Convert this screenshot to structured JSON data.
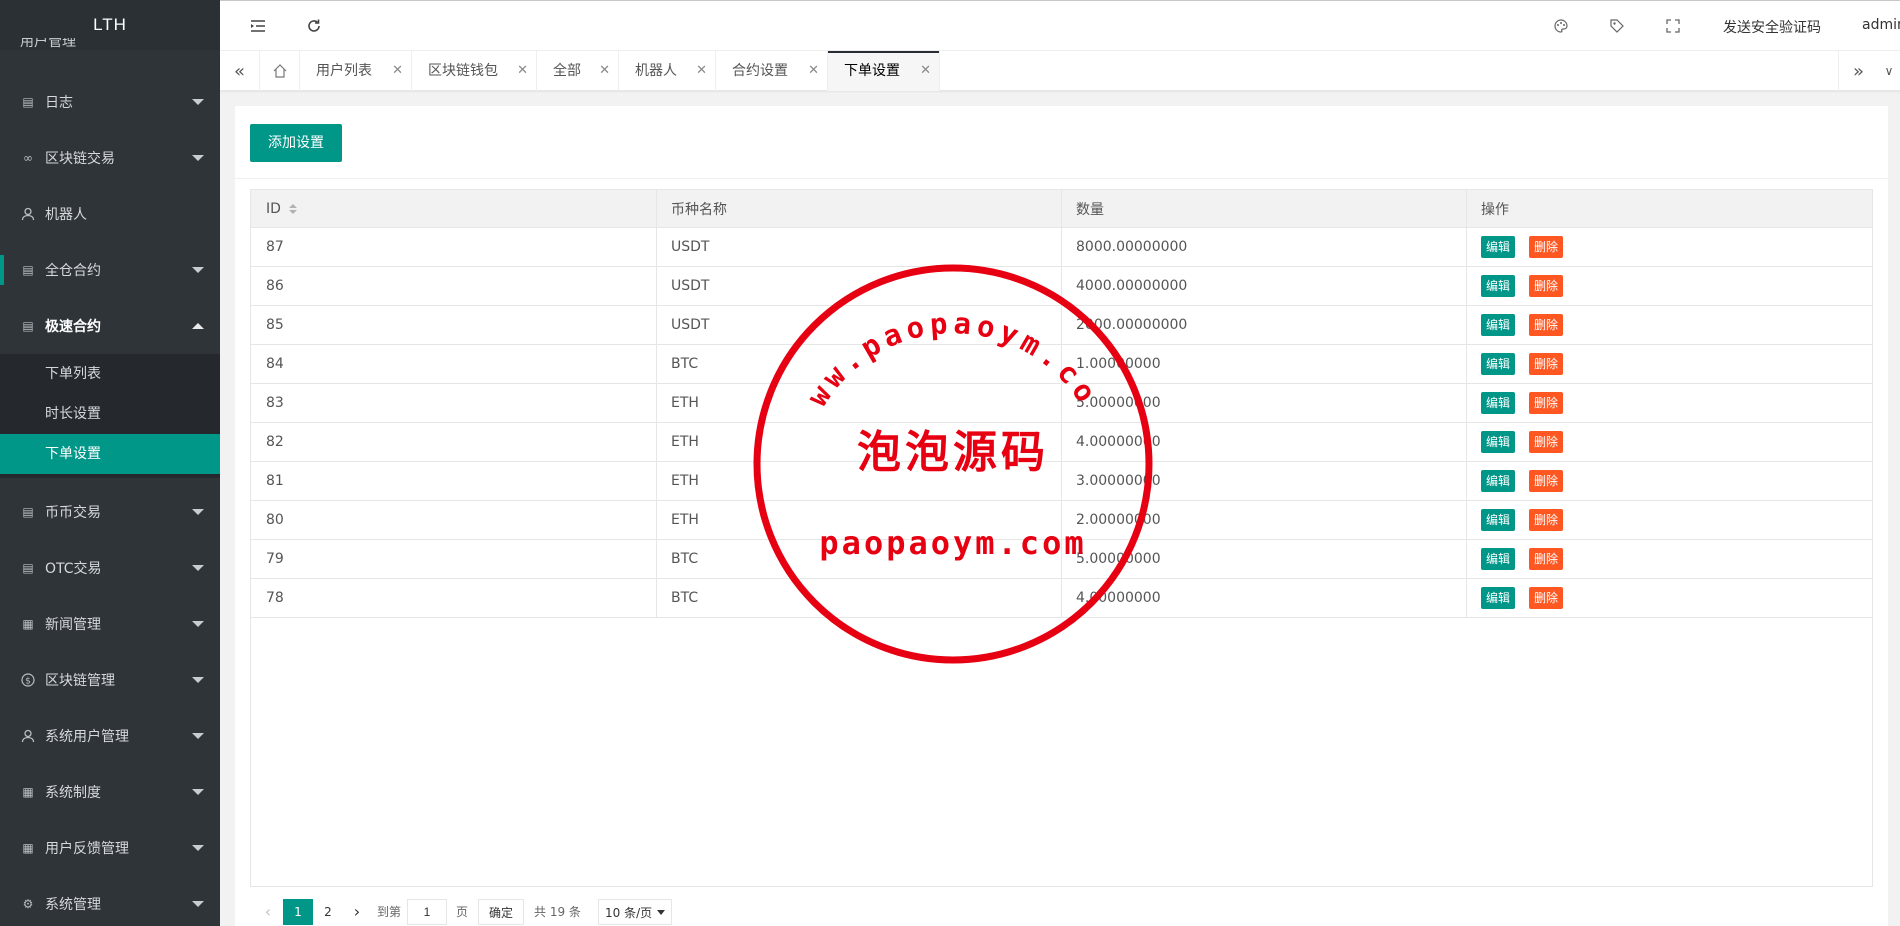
{
  "sidebar": {
    "logo": "LTH",
    "partial_item": "用户管理",
    "items": [
      {
        "label": "日志",
        "icon": "doc-icon",
        "arrow": "down"
      },
      {
        "label": "区块链交易",
        "icon": "link-icon",
        "arrow": "down"
      },
      {
        "label": "机器人",
        "icon": "user-icon",
        "arrow": ""
      },
      {
        "label": "全仓合约",
        "icon": "doc-icon",
        "arrow": "down"
      },
      {
        "label": "极速合约",
        "icon": "doc-icon",
        "arrow": "up"
      },
      {
        "label": "币币交易",
        "icon": "doc-icon",
        "arrow": "down"
      },
      {
        "label": "OTC交易",
        "icon": "doc-icon",
        "arrow": "down"
      },
      {
        "label": "新闻管理",
        "icon": "news-icon",
        "arrow": "down"
      },
      {
        "label": "区块链管理",
        "icon": "dollar-icon",
        "arrow": "down"
      },
      {
        "label": "系统用户管理",
        "icon": "user-icon",
        "arrow": "down"
      },
      {
        "label": "系统制度",
        "icon": "news-icon",
        "arrow": "down"
      },
      {
        "label": "用户反馈管理",
        "icon": "news-icon",
        "arrow": "down"
      },
      {
        "label": "系统管理",
        "icon": "gear-icon",
        "arrow": "down"
      }
    ],
    "submenu": [
      "下单列表",
      "时长设置",
      "下单设置"
    ]
  },
  "header": {
    "send_code": "发送安全验证码",
    "user": "admin"
  },
  "tabs": [
    "用户列表",
    "区块链钱包",
    "全部",
    "机器人",
    "合约设置",
    "下单设置"
  ],
  "toolbar": {
    "add_label": "添加设置"
  },
  "table": {
    "headers": [
      "ID",
      "币种名称",
      "数量",
      "操作"
    ],
    "edit_label": "编辑",
    "delete_label": "删除",
    "rows": [
      {
        "id": "87",
        "coin": "USDT",
        "amount": "8000.00000000"
      },
      {
        "id": "86",
        "coin": "USDT",
        "amount": "4000.00000000"
      },
      {
        "id": "85",
        "coin": "USDT",
        "amount": "2000.00000000"
      },
      {
        "id": "84",
        "coin": "BTC",
        "amount": "1.00000000"
      },
      {
        "id": "83",
        "coin": "ETH",
        "amount": "5.00000000"
      },
      {
        "id": "82",
        "coin": "ETH",
        "amount": "4.00000000"
      },
      {
        "id": "81",
        "coin": "ETH",
        "amount": "3.00000000"
      },
      {
        "id": "80",
        "coin": "ETH",
        "amount": "2.00000000"
      },
      {
        "id": "79",
        "coin": "BTC",
        "amount": "5.00000000"
      },
      {
        "id": "78",
        "coin": "BTC",
        "amount": "4.00000000"
      }
    ]
  },
  "pager": {
    "pages": [
      "1",
      "2"
    ],
    "goto_label": "到第",
    "goto_value": "1",
    "page_unit": "页",
    "confirm": "确定",
    "total": "共 19 条",
    "per_page": "10 条/页"
  },
  "watermark": {
    "arc_text": "www.paopaoym.com",
    "center_text": "泡泡源码",
    "bottom_text": "paopaoym.com"
  },
  "colors": {
    "accent": "#009688",
    "danger": "#ff5722",
    "sidebar_bg": "#2f3439",
    "stamp": "#e60012"
  }
}
